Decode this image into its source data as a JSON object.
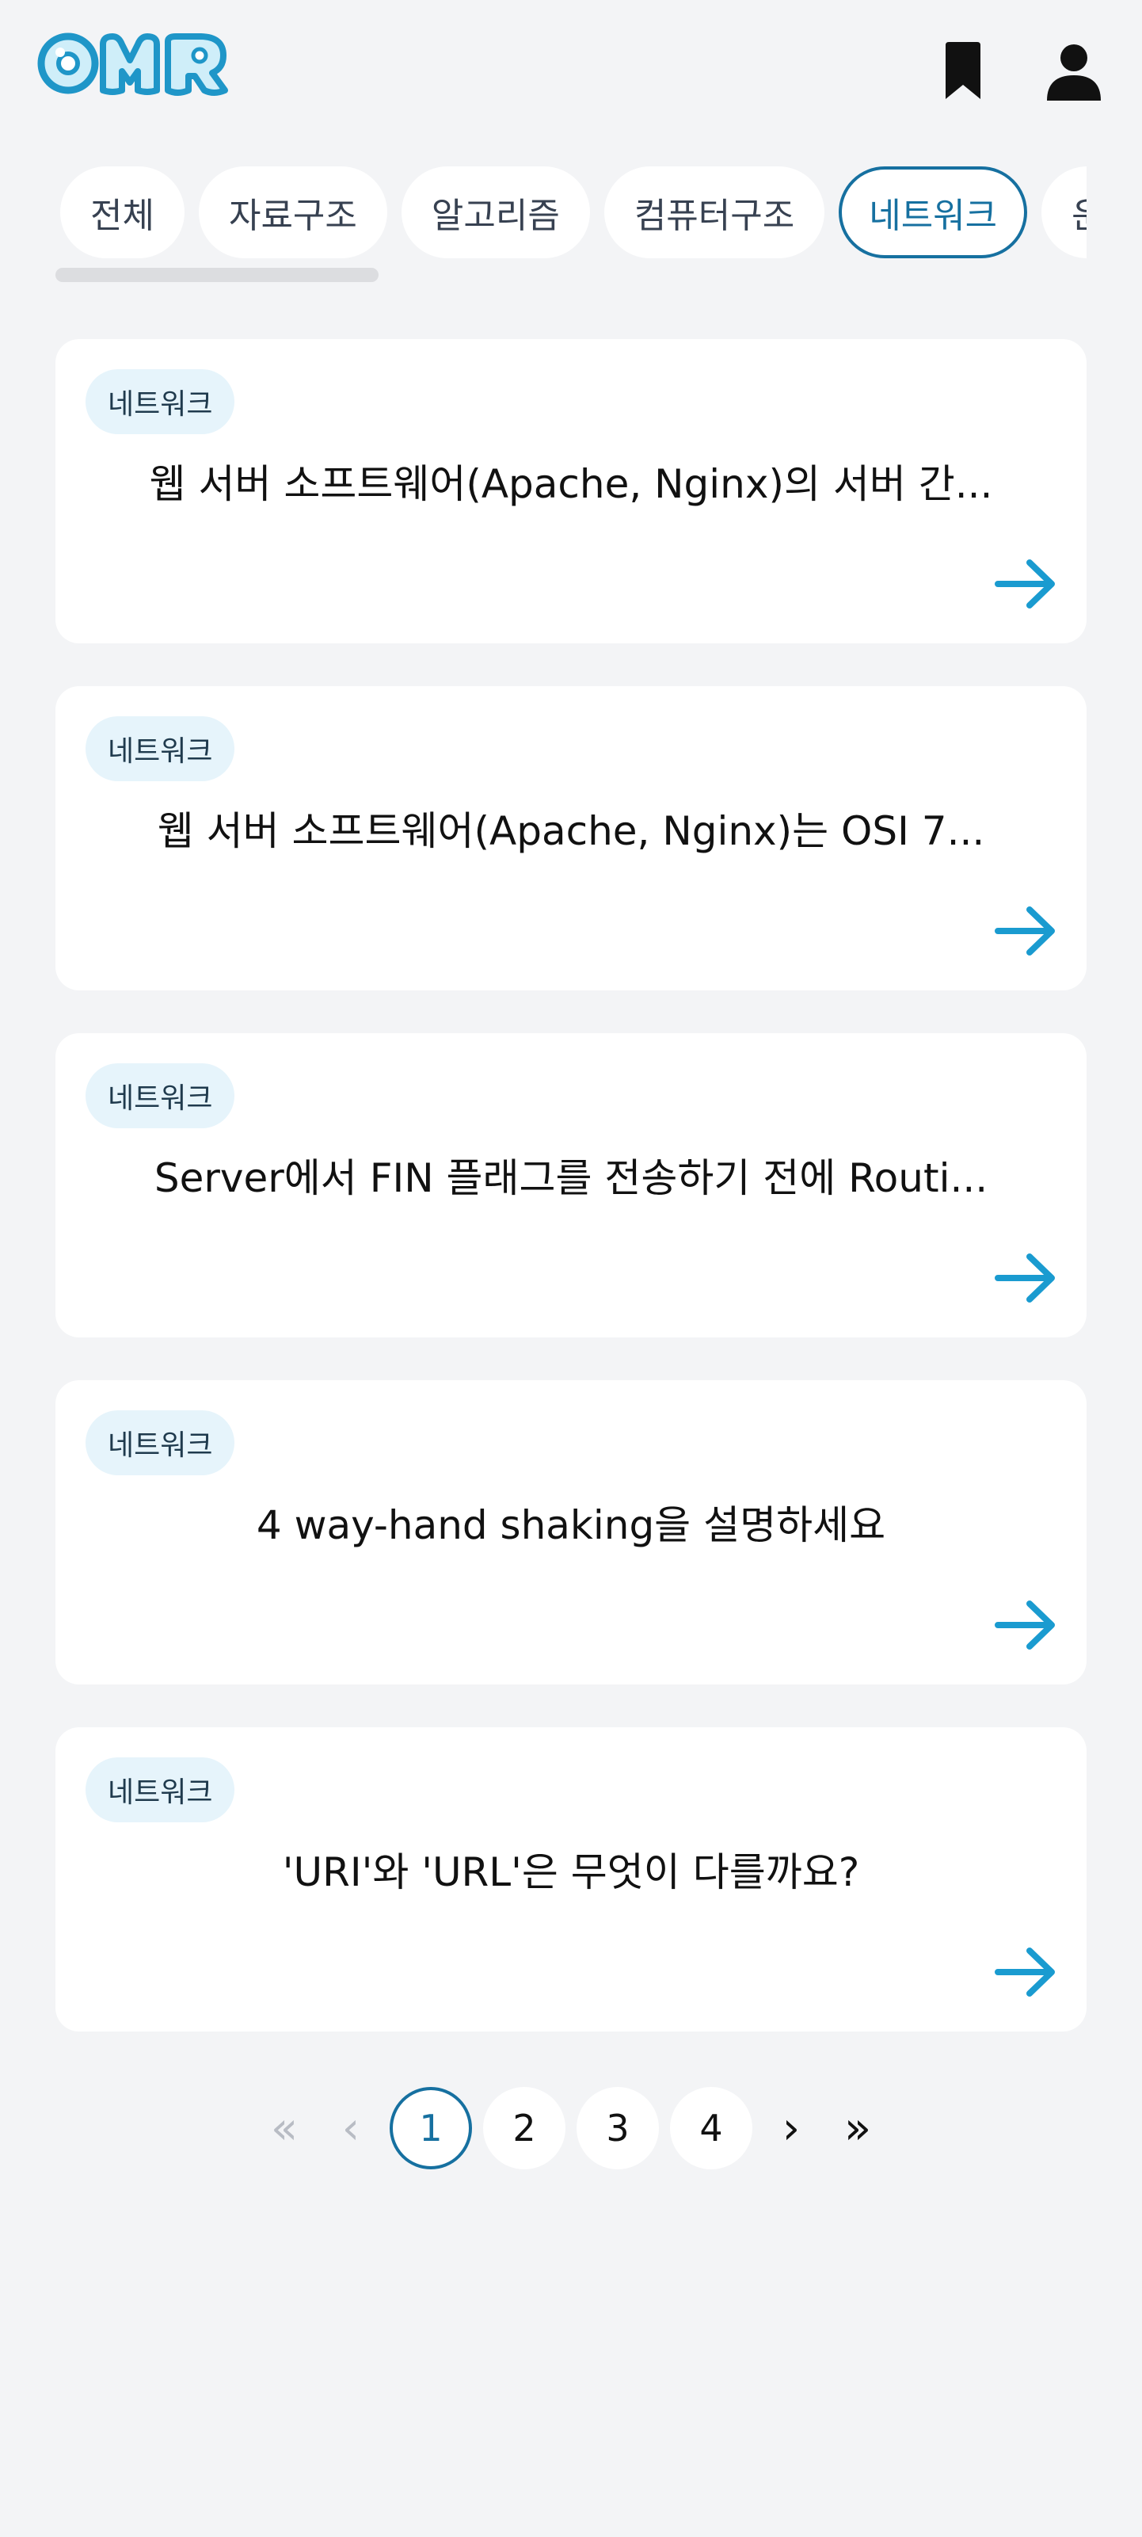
{
  "header": {
    "logo_text": "OMR",
    "bookmark_icon": "bookmark-icon",
    "profile_icon": "user-icon"
  },
  "colors": {
    "accent": "#1670a0",
    "arrow": "#1a9bd0",
    "badge_bg": "#e6f4fb",
    "page_bg": "#f3f4f6"
  },
  "tabs": [
    {
      "label": "전체",
      "active": false
    },
    {
      "label": "자료구조",
      "active": false
    },
    {
      "label": "알고리즘",
      "active": false
    },
    {
      "label": "컴퓨터구조",
      "active": false
    },
    {
      "label": "네트워크",
      "active": true
    },
    {
      "label": "운",
      "active": false
    }
  ],
  "questions": [
    {
      "category": "네트워크",
      "title": "웹 서버 소프트웨어(Apache, Nginx)의 서버 간...",
      "arrow_icon": "arrow-right-icon"
    },
    {
      "category": "네트워크",
      "title": "웹 서버 소프트웨어(Apache, Nginx)는 OSI 7...",
      "arrow_icon": "arrow-right-icon"
    },
    {
      "category": "네트워크",
      "title": "Server에서 FIN 플래그를 전송하기 전에 Routi...",
      "arrow_icon": "arrow-right-icon"
    },
    {
      "category": "네트워크",
      "title": "4 way-hand shaking을 설명하세요",
      "arrow_icon": "arrow-right-icon"
    },
    {
      "category": "네트워크",
      "title": "'URI'와 'URL'은 무엇이 다를까요?",
      "arrow_icon": "arrow-right-icon"
    }
  ],
  "pagination": {
    "first": "«",
    "prev": "‹",
    "next": "›",
    "last": "»",
    "pages": [
      "1",
      "2",
      "3",
      "4"
    ],
    "current": "1"
  }
}
